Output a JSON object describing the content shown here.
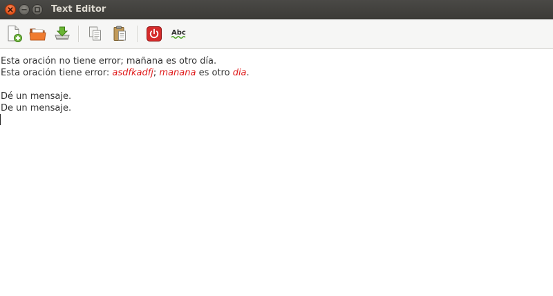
{
  "window": {
    "title": "Text Editor"
  },
  "toolbar": {
    "buttons": [
      {
        "name": "new",
        "icon": "new-document-icon"
      },
      {
        "name": "open",
        "icon": "open-folder-icon"
      },
      {
        "name": "save",
        "icon": "save-icon"
      },
      {
        "name": "copy",
        "icon": "copy-icon"
      },
      {
        "name": "paste",
        "icon": "paste-icon"
      },
      {
        "name": "quit",
        "icon": "power-icon"
      },
      {
        "name": "spellcheck",
        "icon": "spellcheck-icon",
        "label": "Abc"
      }
    ]
  },
  "editor": {
    "line1": "Esta oración no tiene error; mañana es otro día.",
    "line2": {
      "prefix": "Esta oración tiene error: ",
      "err1": "asdfkadfj",
      "sep": "; ",
      "err2": "manana",
      "mid": " es otro ",
      "err3": "dia",
      "suffix": "."
    },
    "line4": "Dé un mensaje.",
    "line5": "De un mensaje."
  },
  "colors": {
    "titlebar": "#3c3b37",
    "close_button": "#e2531b",
    "misspelled": "#e01b1b"
  }
}
